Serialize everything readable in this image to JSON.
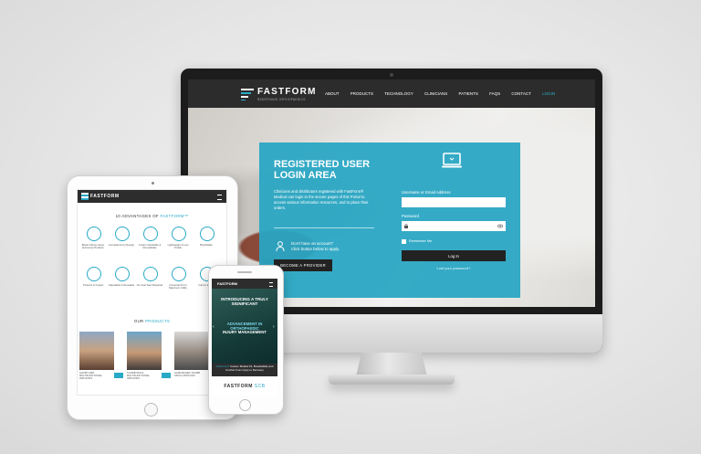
{
  "desktop": {
    "nav": {
      "brand": "FASTFORM",
      "tagline": "REDEFINING ORTHOPAEDICS",
      "menu": [
        "ABOUT",
        "PRODUCTS",
        "TECHNOLOGY",
        "CLINICIANS",
        "PATIENTS",
        "FAQS",
        "CONTACT",
        "LOGIN"
      ],
      "active_index": 7
    },
    "login": {
      "title": "REGISTERED USER LOGIN AREA",
      "body": "Clinicians and distributors registered with FastForm® Medical can login to the secure pages of this Portal to access various information resources, and to place their orders.",
      "question": "Don't have an account?",
      "question_sub": "Click button below to apply.",
      "provider_button": "BECOME A PROVIDER",
      "username_label": "Username or Email Address",
      "password_label": "Password",
      "remember_label": "Remember Me",
      "login_button": "Log In",
      "lost_password": "Lost your password?"
    },
    "colors": {
      "accent": "#29a9c6",
      "nav": "#2c2c2c"
    }
  },
  "tablet": {
    "brand": "FASTFORM",
    "heading_prefix": "10 ADVANTAGES OF",
    "heading_brand": "FASTFORM™",
    "advantages_row1": [
      "Better-Fitting Upper Extremity Products",
      "Compliance by Design",
      "Custom Moldable & Remoldable",
      "Lightweight & Low Profile",
      "Breathable"
    ],
    "advantages_row2": [
      "Protects & Impact",
      "Adjustable & Reusable",
      "No Cast Saw Required",
      "Universal Fit for Maximum Utility",
      "Improv & Con"
    ],
    "products_prefix": "OUR",
    "products_heading": "PRODUCTS",
    "products": [
      "SHORT ARM MULTIFUNCTIONAL ORTHOSIS",
      "THUMB SPICA MULTIFUNCTIONAL ORTHOSIS",
      "HAND-BASED THUMB SPICA ORTHOSIS"
    ]
  },
  "phone": {
    "brand": "FASTFORM",
    "hero_title": "INTRODUCING A TRULY SIGNIFICANT",
    "hero_sub": "ADVANCEMENT IN ORTHOPAEDIC",
    "hero_sub2": "INJURY MANAGEMENT",
    "band_brand": "FastForm®",
    "band_text": "Custom Molded Fit, Breathability and Comfort From Injury to Recovery",
    "footer_brand": "FASTFORM",
    "footer_suffix": "SCB"
  }
}
